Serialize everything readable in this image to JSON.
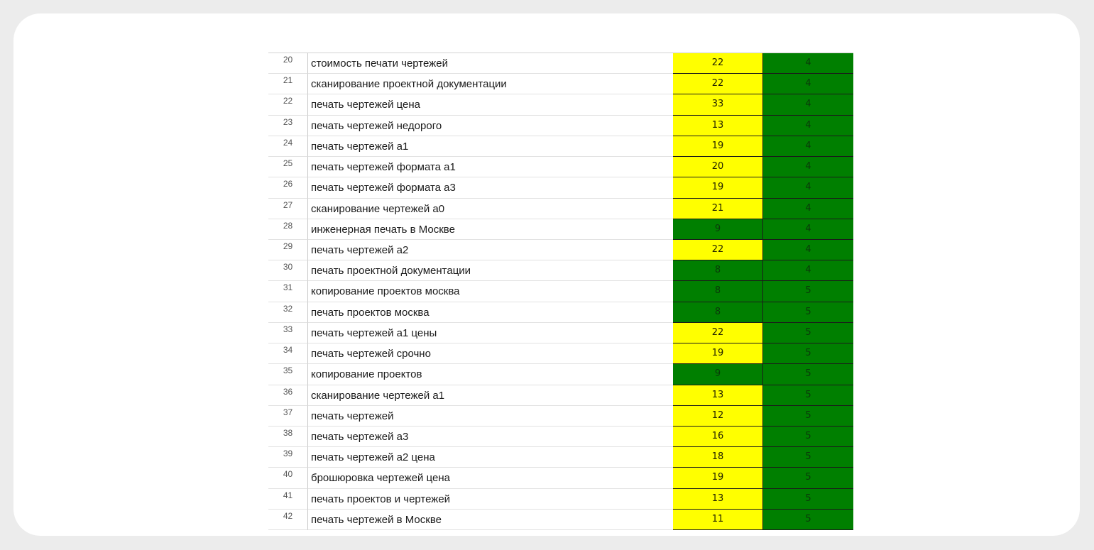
{
  "colors": {
    "yellow": "#ffff00",
    "green": "#007f00"
  },
  "rows": [
    {
      "num": "20",
      "keyword": "стоимость печати чертежей",
      "a": "22",
      "a_color": "yellow",
      "b": "4",
      "b_color": "green"
    },
    {
      "num": "21",
      "keyword": "сканирование проектной документации",
      "a": "22",
      "a_color": "yellow",
      "b": "4",
      "b_color": "green"
    },
    {
      "num": "22",
      "keyword": "печать чертежей цена",
      "a": "33",
      "a_color": "yellow",
      "b": "4",
      "b_color": "green"
    },
    {
      "num": "23",
      "keyword": "печать чертежей недорого",
      "a": "13",
      "a_color": "yellow",
      "b": "4",
      "b_color": "green"
    },
    {
      "num": "24",
      "keyword": "печать чертежей а1",
      "a": "19",
      "a_color": "yellow",
      "b": "4",
      "b_color": "green"
    },
    {
      "num": "25",
      "keyword": "печать чертежей формата а1",
      "a": "20",
      "a_color": "yellow",
      "b": "4",
      "b_color": "green"
    },
    {
      "num": "26",
      "keyword": "печать чертежей формата а3",
      "a": "19",
      "a_color": "yellow",
      "b": "4",
      "b_color": "green"
    },
    {
      "num": "27",
      "keyword": "сканирование чертежей а0",
      "a": "21",
      "a_color": "yellow",
      "b": "4",
      "b_color": "green"
    },
    {
      "num": "28",
      "keyword": "инженерная печать в Москве",
      "a": "9",
      "a_color": "green",
      "b": "4",
      "b_color": "green"
    },
    {
      "num": "29",
      "keyword": "печать чертежей а2",
      "a": "22",
      "a_color": "yellow",
      "b": "4",
      "b_color": "green"
    },
    {
      "num": "30",
      "keyword": "печать проектной документации",
      "a": "8",
      "a_color": "green",
      "b": "4",
      "b_color": "green"
    },
    {
      "num": "31",
      "keyword": "копирование проектов москва",
      "a": "8",
      "a_color": "green",
      "b": "5",
      "b_color": "green"
    },
    {
      "num": "32",
      "keyword": "печать проектов москва",
      "a": "8",
      "a_color": "green",
      "b": "5",
      "b_color": "green"
    },
    {
      "num": "33",
      "keyword": "печать чертежей а1 цены",
      "a": "22",
      "a_color": "yellow",
      "b": "5",
      "b_color": "green"
    },
    {
      "num": "34",
      "keyword": "печать чертежей срочно",
      "a": "19",
      "a_color": "yellow",
      "b": "5",
      "b_color": "green"
    },
    {
      "num": "35",
      "keyword": "копирование проектов",
      "a": "9",
      "a_color": "green",
      "b": "5",
      "b_color": "green"
    },
    {
      "num": "36",
      "keyword": "сканирование чертежей а1",
      "a": "13",
      "a_color": "yellow",
      "b": "5",
      "b_color": "green"
    },
    {
      "num": "37",
      "keyword": "печать чертежей",
      "a": "12",
      "a_color": "yellow",
      "b": "5",
      "b_color": "green"
    },
    {
      "num": "38",
      "keyword": "печать чертежей а3",
      "a": "16",
      "a_color": "yellow",
      "b": "5",
      "b_color": "green"
    },
    {
      "num": "39",
      "keyword": "печать чертежей а2 цена",
      "a": "18",
      "a_color": "yellow",
      "b": "5",
      "b_color": "green"
    },
    {
      "num": "40",
      "keyword": "брошюровка чертежей цена",
      "a": "19",
      "a_color": "yellow",
      "b": "5",
      "b_color": "green"
    },
    {
      "num": "41",
      "keyword": "печать проектов и чертежей",
      "a": "13",
      "a_color": "yellow",
      "b": "5",
      "b_color": "green"
    },
    {
      "num": "42",
      "keyword": "печать чертежей в Москве",
      "a": "11",
      "a_color": "yellow",
      "b": "5",
      "b_color": "green"
    }
  ]
}
